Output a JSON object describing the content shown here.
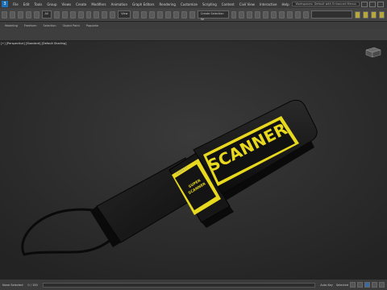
{
  "app": {
    "logo": "3"
  },
  "menu": {
    "items": [
      "File",
      "Edit",
      "Tools",
      "Group",
      "Views",
      "Create",
      "Modifiers",
      "Animation",
      "Graph Editors",
      "Rendering",
      "Customize",
      "Scripting",
      "Content",
      "Civil View",
      "Interactive",
      "Help"
    ],
    "workspace": "Workspaces: Default with Enhanced Menus"
  },
  "toolbar": {
    "filter": "All",
    "viewport_dropdown": "View",
    "create_selection_set": "Create Selection Se"
  },
  "ribbon": {
    "tabs": [
      "Modeling",
      "Freeform",
      "Selection",
      "Object Paint",
      "Populate"
    ]
  },
  "viewport": {
    "label": "[+] [Perspective] [Standard] [Default Shading]",
    "model": {
      "main_text": "SCANNER",
      "panel_text_1": "SUPER",
      "panel_text_2": "SCANNER",
      "small_text": "GARRETT"
    }
  },
  "status": {
    "selected": "None Selected",
    "frame": "0 / 100",
    "key_mode": "Auto Key",
    "selected_label": "Selected"
  },
  "colors": {
    "accent": "#4b7bb0",
    "model_yellow": "#e8d91f",
    "model_black": "#141414"
  }
}
